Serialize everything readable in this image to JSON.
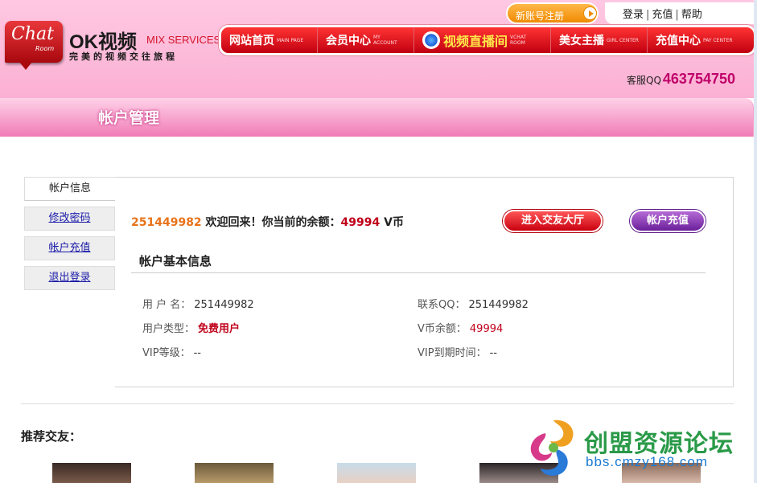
{
  "header": {
    "logo_chat": "Chat",
    "logo_room": "Room",
    "brand_name": "OK视频",
    "brand_sub": "MIX SERVICES",
    "slogan": "完美的视频交往旅程",
    "register_label": "新账号注册",
    "top_links": [
      "登录",
      "充值",
      "帮助"
    ],
    "service_label": "客服QQ",
    "service_qq": "463754750"
  },
  "nav": [
    {
      "label": "网站首页",
      "sub": "MAIN PAGE"
    },
    {
      "label": "会员中心",
      "sub": "MY ACCOUNT"
    },
    {
      "label": "视频直播间",
      "sub": "VCHAT ROOM"
    },
    {
      "label": "美女主播",
      "sub": "GIRL CENTER"
    },
    {
      "label": "充值中心",
      "sub": "PAY CENTER"
    }
  ],
  "page_title": "帐户管理",
  "sidebar": {
    "items": [
      {
        "label": "帐户信息"
      },
      {
        "label": "修改密码"
      },
      {
        "label": "帐户充值"
      },
      {
        "label": "退出登录"
      }
    ]
  },
  "welcome": {
    "user_id": "251449982",
    "text": " 欢迎回来！你当前的余额：",
    "balance": "49994",
    "unit": " V币"
  },
  "buttons": {
    "lobby": "进入交友大厅",
    "recharge": "帐户充值"
  },
  "account": {
    "section_title": "帐户基本信息",
    "username_label": "用 户 名：",
    "username": "251449982",
    "qq_label": "联系QQ：",
    "qq": "251449982",
    "type_label": "用户类型：",
    "type": "免费用户",
    "balance_label": "V币余额：",
    "balance": "49994",
    "vip_label": "VIP等级：",
    "vip": "--",
    "vip_expire_label": "VIP到期时间：",
    "vip_expire": "--"
  },
  "recommend_title": "推荐交友：",
  "watermark": {
    "title": "创盟资源论坛",
    "url": "bbs.cmzy168.com"
  }
}
